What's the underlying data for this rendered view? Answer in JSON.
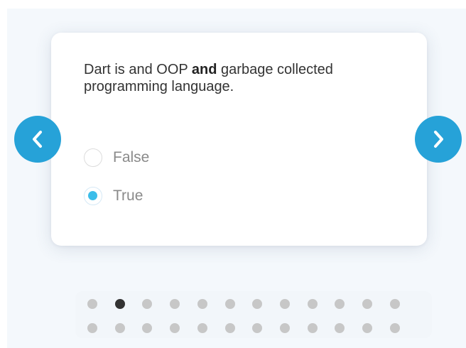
{
  "quiz": {
    "question_before": "Dart is and OOP ",
    "question_bold": "and",
    "question_after": " garbage collected programming language.",
    "options": [
      {
        "label": "False",
        "selected": false
      },
      {
        "label": "True",
        "selected": true
      }
    ]
  },
  "navigation": {
    "prev_icon": "chevron-left-icon",
    "next_icon": "chevron-right-icon"
  },
  "pagination": {
    "total": 24,
    "columns": 12,
    "active_index": 1
  },
  "colors": {
    "accent": "#26a2d8",
    "radio_fill": "#3cbde9",
    "dot_active": "#333333",
    "dot_inactive": "#c7c7c7"
  }
}
